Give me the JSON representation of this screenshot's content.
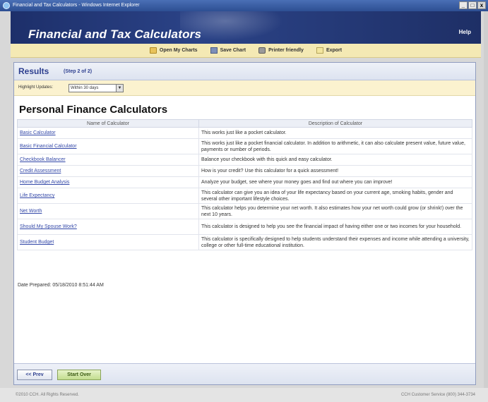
{
  "window": {
    "title": "Financial and Tax Calculators - Windows Internet Explorer",
    "min": "_",
    "max": "□",
    "close": "x"
  },
  "header": {
    "title": "Financial and Tax Calculators",
    "help": "Help"
  },
  "toolbar": {
    "open": "Open My Charts",
    "save": "Save Chart",
    "print": "Printer friendly",
    "export": "Export"
  },
  "results": {
    "title": "Results",
    "step": "(Step 2 of 2)"
  },
  "highlight": {
    "label": "Highlight Updates:",
    "value": "Within 30 days",
    "arrow": "▼"
  },
  "section": {
    "title": "Personal Finance Calculators"
  },
  "table": {
    "headers": [
      "Name of Calculator",
      "Description of Calculator"
    ],
    "rows": [
      {
        "name": "Basic Calculator",
        "desc": "This works just like a pocket calculator."
      },
      {
        "name": "Basic Financial Calculator",
        "desc": "This works just like a pocket financial calculator. In addition to arithmetic, it can also calculate present value, future value, payments or number of periods."
      },
      {
        "name": "Checkbook Balancer",
        "desc": "Balance your checkbook with this quick and easy calculator."
      },
      {
        "name": "Credit Assessment",
        "desc": "How is your credit? Use this calculator for a quick assessment!"
      },
      {
        "name": "Home Budget Analysis",
        "desc": "Analyze your budget, see where your money goes and find out where you can improve!"
      },
      {
        "name": "Life Expectancy",
        "desc": "This calculator can give you an idea of your life expectancy based on your current age, smoking habits, gender and several other important lifestyle choices."
      },
      {
        "name": "Net Worth",
        "desc": "This calculator helps you determine your net worth. It also estimates how your net worth could grow (or shrink!) over the next 10 years."
      },
      {
        "name": "Should My Spouse Work?",
        "desc": "This calculator is designed to help you see the financial impact of having either one or two incomes for your household."
      },
      {
        "name": "Student Budget",
        "desc": "This calculator is specifically designed to help students understand their expenses and income while attending a university, college or other full-time educational institution."
      }
    ]
  },
  "date_prepared": "Date Prepared: 05/18/2010 8:51:44 AM",
  "buttons": {
    "prev": "<< Prev",
    "start_over": "Start Over"
  },
  "status": {
    "left": "©2010 CCH. All Rights Reserved.",
    "right": "CCH Customer Service (800) 344-3734"
  }
}
